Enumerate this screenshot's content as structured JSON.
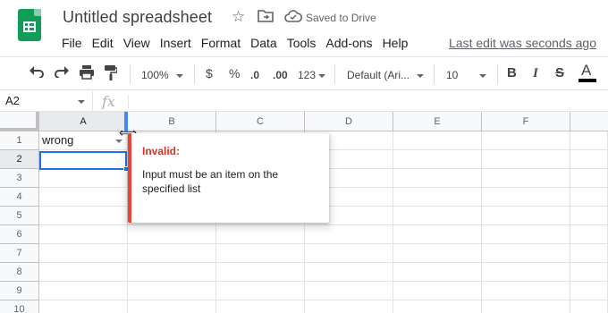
{
  "header": {
    "title": "Untitled spreadsheet",
    "saved_status": "Saved to Drive",
    "last_edit": "Last edit was seconds ago",
    "menu": [
      "File",
      "Edit",
      "View",
      "Insert",
      "Format",
      "Data",
      "Tools",
      "Add-ons",
      "Help"
    ]
  },
  "toolbar": {
    "zoom": "100%",
    "currency": "$",
    "percent": "%",
    "decrease_decimal": ".0",
    "increase_decimal": ".00",
    "more_formats": "123",
    "font": "Default (Ari...",
    "font_size": "10",
    "bold": "B",
    "italic": "I",
    "strike": "S",
    "text_color": "A"
  },
  "formula_bar": {
    "name_box": "A2",
    "fx_label": "fx",
    "value": ""
  },
  "sheet": {
    "columns": [
      "A",
      "B",
      "C",
      "D",
      "E",
      "F"
    ],
    "rows": [
      "1",
      "2",
      "3",
      "4",
      "5",
      "6",
      "7",
      "8",
      "9",
      "10"
    ],
    "selected_cell": "A2",
    "cells": {
      "A1": "wrong"
    }
  },
  "validation_popup": {
    "title": "Invalid:",
    "message": "Input must be an item on the specified list"
  },
  "colors": {
    "brand_green": "#0f9d58",
    "selection_blue": "#1a73e8",
    "error_red": "#ea4335"
  }
}
